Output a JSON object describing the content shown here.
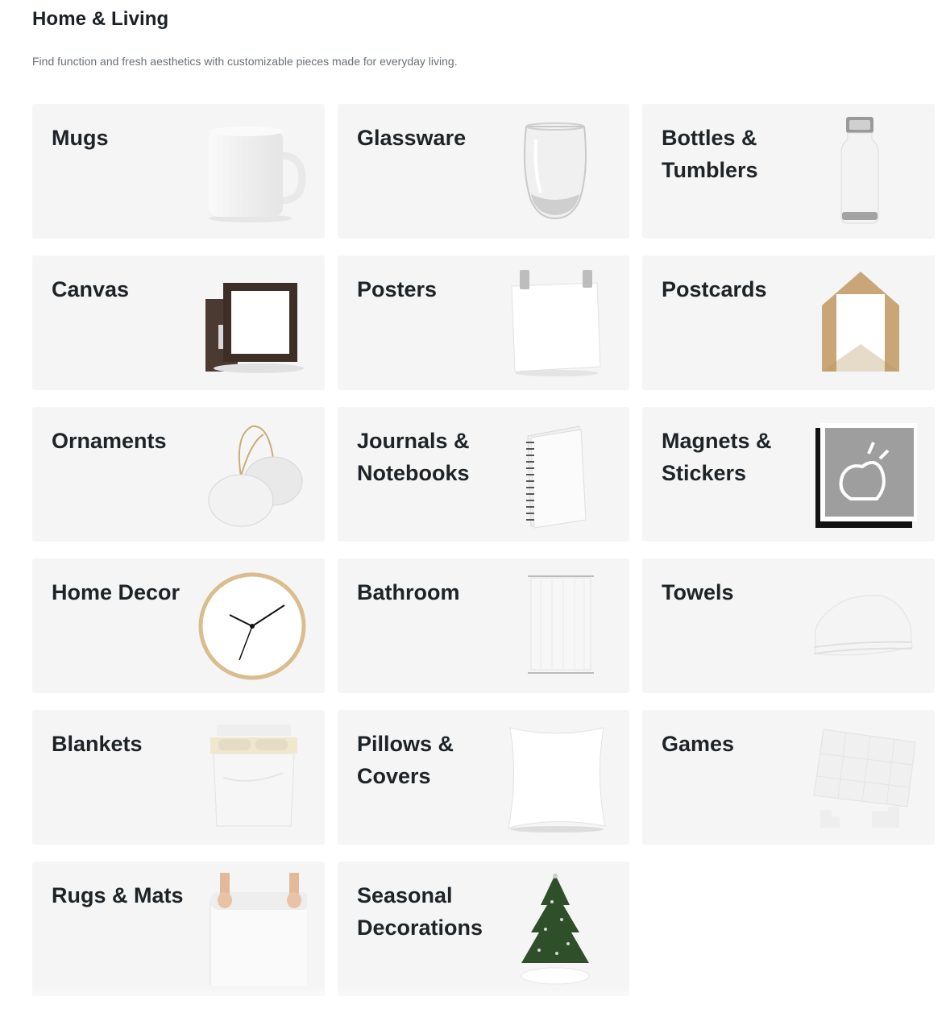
{
  "header": {
    "title": "Home & Living",
    "subtitle": "Find function and fresh aesthetics with customizable pieces made for everyday living."
  },
  "categories": [
    {
      "label": "Mugs",
      "icon": "mug-image"
    },
    {
      "label": "Glassware",
      "icon": "glass-image"
    },
    {
      "label": "Bottles & Tumblers",
      "icon": "bottle-image"
    },
    {
      "label": "Canvas",
      "icon": "canvas-image"
    },
    {
      "label": "Posters",
      "icon": "poster-image"
    },
    {
      "label": "Postcards",
      "icon": "postcard-envelope-image"
    },
    {
      "label": "Ornaments",
      "icon": "ornaments-image"
    },
    {
      "label": "Journals & Notebooks",
      "icon": "notebook-image"
    },
    {
      "label": "Magnets & Stickers",
      "icon": "sticker-image"
    },
    {
      "label": "Home Decor",
      "icon": "clock-image"
    },
    {
      "label": "Bathroom",
      "icon": "shower-curtain-image"
    },
    {
      "label": "Towels",
      "icon": "towel-image"
    },
    {
      "label": "Blankets",
      "icon": "blanket-bed-image"
    },
    {
      "label": "Pillows & Covers",
      "icon": "pillow-image"
    },
    {
      "label": "Games",
      "icon": "puzzle-image"
    },
    {
      "label": "Rugs & Mats",
      "icon": "rug-image"
    },
    {
      "label": "Seasonal Decorations",
      "icon": "christmas-tree-image"
    }
  ],
  "colors": {
    "card_background": "#f5f5f5",
    "text_primary": "#1d2327",
    "text_secondary": "#6b7075"
  }
}
